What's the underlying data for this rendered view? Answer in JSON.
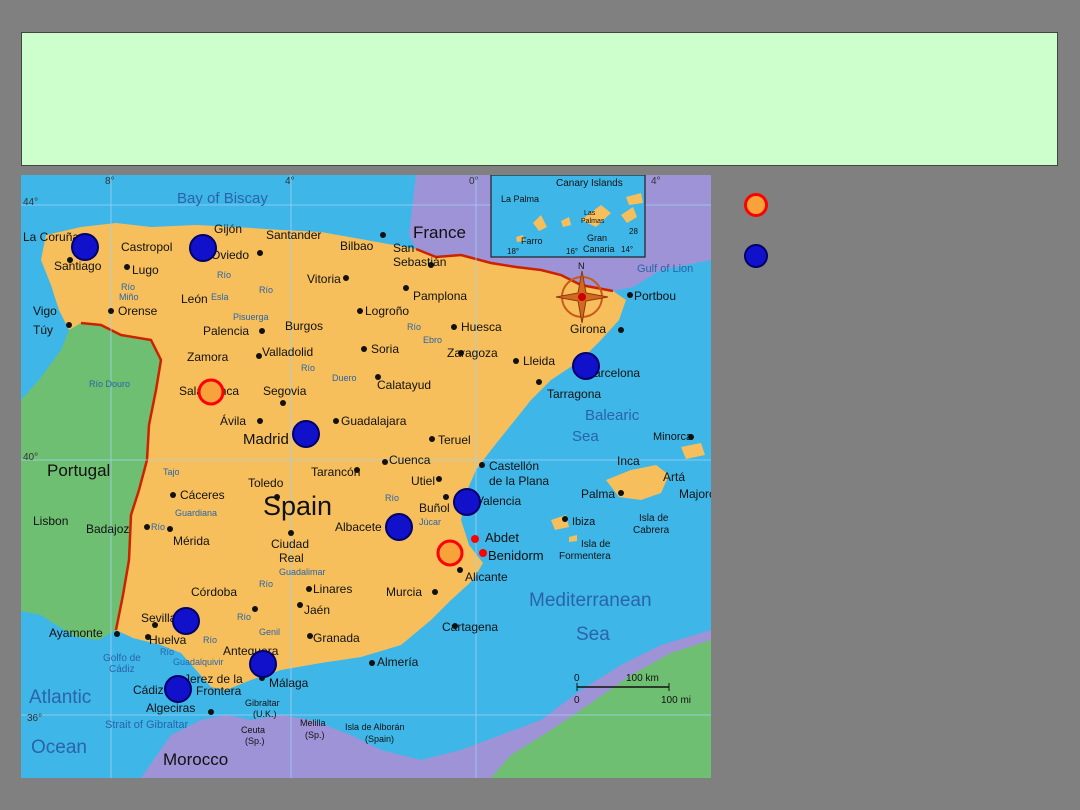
{
  "slide": {
    "title": ""
  },
  "map": {
    "graticule": {
      "lon_8w": "8°",
      "lon_4w": "4°",
      "lon_0": "0°",
      "lon_4e": "4°",
      "lat_44": "44°",
      "lat_40": "40°",
      "lat_36": "36°"
    },
    "water": {
      "bay": "Bay of Biscay",
      "gulf_lion": "Gulf of Lion",
      "balearic": "Balearic",
      "balearic2": "Sea",
      "med": "Mediterranean",
      "med2": "Sea",
      "atlantic": "Atlantic",
      "atlantic2": "Ocean",
      "golfo": "Golfo de",
      "golfo2": "Cádiz",
      "gibraltar": "Strait of Gibraltar"
    },
    "countries": {
      "spain": "Spain",
      "portugal": "Portugal",
      "france": "France",
      "morocco": "Morocco"
    },
    "cities": [
      {
        "name": "La Coruña"
      },
      {
        "name": "Santiago"
      },
      {
        "name": "Castropol"
      },
      {
        "name": "Gijón"
      },
      {
        "name": "Oviedo"
      },
      {
        "name": "Santander"
      },
      {
        "name": "Bilbao"
      },
      {
        "name": "San"
      },
      {
        "name": "Sebastián"
      },
      {
        "name": "Lugo"
      },
      {
        "name": "Vitoria"
      },
      {
        "name": "Pamplona"
      },
      {
        "name": "Portbou"
      },
      {
        "name": "Vigo"
      },
      {
        "name": "Túy"
      },
      {
        "name": "Orense"
      },
      {
        "name": "León"
      },
      {
        "name": "Logroño"
      },
      {
        "name": "Huesca"
      },
      {
        "name": "Girona"
      },
      {
        "name": "Palencia"
      },
      {
        "name": "Burgos"
      },
      {
        "name": "Zamora"
      },
      {
        "name": "Valladolid"
      },
      {
        "name": "Soria"
      },
      {
        "name": "Zaragoza"
      },
      {
        "name": "Lleida"
      },
      {
        "name": "Barcelona"
      },
      {
        "name": "Salamanca"
      },
      {
        "name": "Segovia"
      },
      {
        "name": "Calatayud"
      },
      {
        "name": "Tarragona"
      },
      {
        "name": "Ávila"
      },
      {
        "name": "Guadalajara"
      },
      {
        "name": "Madrid"
      },
      {
        "name": "Teruel"
      },
      {
        "name": "Tarancón"
      },
      {
        "name": "Cuenca"
      },
      {
        "name": "Castellón"
      },
      {
        "name": "de la Plana"
      },
      {
        "name": "Cáceres"
      },
      {
        "name": "Toledo"
      },
      {
        "name": "Utiel"
      },
      {
        "name": "Buñol"
      },
      {
        "name": "Valencia"
      },
      {
        "name": "Lisbon"
      },
      {
        "name": "Badajoz"
      },
      {
        "name": "Mérida"
      },
      {
        "name": "Albacete"
      },
      {
        "name": "Ciudad"
      },
      {
        "name": "Real"
      },
      {
        "name": "Abdet"
      },
      {
        "name": "Benidorm"
      },
      {
        "name": "Alicante"
      },
      {
        "name": "Córdoba"
      },
      {
        "name": "Linares"
      },
      {
        "name": "Murcia"
      },
      {
        "name": "Jaén"
      },
      {
        "name": "Sevilla"
      },
      {
        "name": "Ayamonte"
      },
      {
        "name": "Huelva"
      },
      {
        "name": "Granada"
      },
      {
        "name": "Cartagena"
      },
      {
        "name": "Antequera"
      },
      {
        "name": "Almería"
      },
      {
        "name": "Jerez de la"
      },
      {
        "name": "Frontera"
      },
      {
        "name": "Málaga"
      },
      {
        "name": "Cádiz"
      },
      {
        "name": "Algeciras"
      },
      {
        "name": "Gibraltar"
      },
      {
        "name": "(U.K.)"
      },
      {
        "name": "Ceuta"
      },
      {
        "name": "(Sp.)"
      },
      {
        "name": "Melilla"
      },
      {
        "name": "(Sp.)"
      },
      {
        "name": "Isla de Alborán"
      },
      {
        "name": "(Spain)"
      },
      {
        "name": "Palma"
      },
      {
        "name": "Majorca"
      },
      {
        "name": "Minorca"
      },
      {
        "name": "Inca"
      },
      {
        "name": "Artá"
      },
      {
        "name": "Ibiza"
      },
      {
        "name": "Isla de"
      },
      {
        "name": "Formentera"
      },
      {
        "name": "Isla de"
      },
      {
        "name": "Cabrera"
      }
    ],
    "rivers": [
      {
        "name": "Río"
      },
      {
        "name": "Miño"
      },
      {
        "name": "Río"
      },
      {
        "name": "Esla"
      },
      {
        "name": "Río"
      },
      {
        "name": "Pisuerga"
      },
      {
        "name": "Río"
      },
      {
        "name": "Ebro"
      },
      {
        "name": "Río"
      },
      {
        "name": "Duero"
      },
      {
        "name": "Río Douro"
      },
      {
        "name": "Tajo"
      },
      {
        "name": "Guardiana"
      },
      {
        "name": "Río"
      },
      {
        "name": "Río"
      },
      {
        "name": "Júcar"
      },
      {
        "name": "Río"
      },
      {
        "name": "Guadalimar"
      },
      {
        "name": "Río"
      },
      {
        "name": "Genil"
      },
      {
        "name": "Río"
      },
      {
        "name": "Guadalquivir"
      },
      {
        "name": "Río"
      }
    ],
    "inset": {
      "title": "Canary Islands",
      "la_palma": "La Palma",
      "las": "Las",
      "palmas": "Palmas",
      "gran": "Gran",
      "canaria": "Canaria",
      "ferro": "Farro",
      "lon18": "18°",
      "lon16": "16°",
      "lon14": "14°",
      "lat28": "28"
    },
    "scale": {
      "km": "100 km",
      "mi": "100 mi",
      "zero1": "0",
      "zero2": "0"
    },
    "compass": {
      "n": "N"
    }
  },
  "markers": {
    "orange": [
      {
        "place": "Salamanca"
      },
      {
        "place": "Abdet"
      }
    ],
    "blue": [
      {
        "place": "Santiago"
      },
      {
        "place": "Oviedo"
      },
      {
        "place": "Barcelona"
      },
      {
        "place": "Madrid"
      },
      {
        "place": "Valencia"
      },
      {
        "place": "Albacete"
      },
      {
        "place": "Sevilla"
      },
      {
        "place": "Málaga"
      },
      {
        "place": "Cádiz"
      }
    ]
  },
  "legend": {
    "orange_label": "",
    "blue_label": ""
  },
  "colors": {
    "land_spain": "#f7bf5c",
    "land_portugal": "#6fbf73",
    "land_france": "#9d93d6",
    "sea": "#3fb6e8",
    "marker_blue": "#1111cc",
    "marker_orange": "#f7a23b",
    "marker_ring": "#ff0000",
    "border": "#cc2200"
  }
}
